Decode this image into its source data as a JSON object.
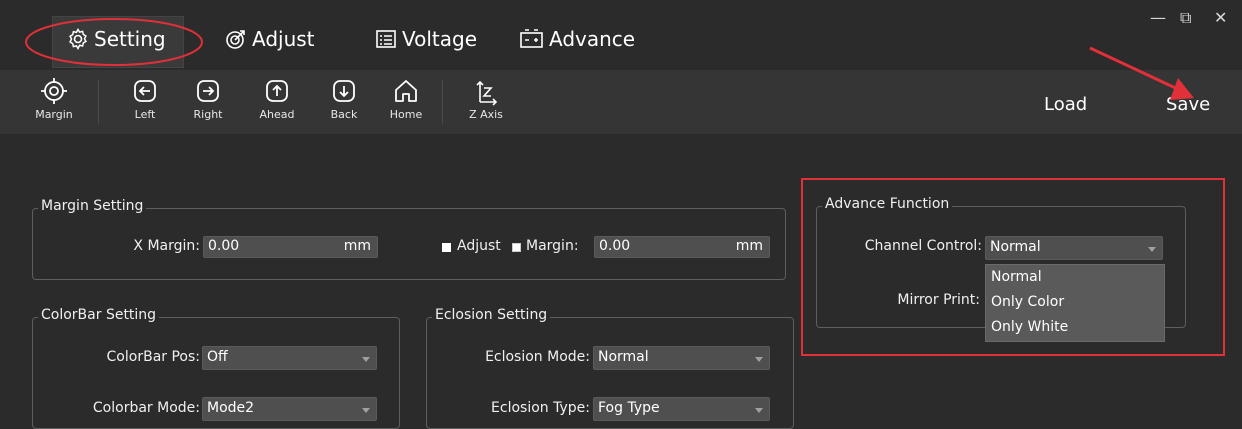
{
  "tabs": [
    {
      "label": "Setting",
      "icon": "gear-icon"
    },
    {
      "label": "Adjust",
      "icon": "target-icon"
    },
    {
      "label": "Voltage",
      "icon": "list-icon"
    },
    {
      "label": "Advance",
      "icon": "battery-icon"
    }
  ],
  "window": {
    "minimize": "—",
    "restore": "⧉",
    "close": "✕"
  },
  "toolbar": {
    "tools": [
      {
        "label": "Margin",
        "icon": "crosshair-icon"
      },
      {
        "label": "Left",
        "icon": "arrow-left-icon"
      },
      {
        "label": "Right",
        "icon": "arrow-right-icon"
      },
      {
        "label": "Ahead",
        "icon": "arrow-up-icon"
      },
      {
        "label": "Back",
        "icon": "arrow-down-icon"
      },
      {
        "label": "Home",
        "icon": "home-icon"
      },
      {
        "label": "Z Axis",
        "icon": "z-axis-icon"
      }
    ],
    "load": "Load",
    "save": "Save"
  },
  "margin_setting": {
    "title": "Margin Setting",
    "x_margin_label": "X Margin:",
    "x_margin_value": "0.00",
    "x_margin_unit": "mm",
    "adjust_label": "Adjust",
    "margin_label": "Margin:",
    "margin_value": "0.00",
    "margin_unit": "mm"
  },
  "colorbar_setting": {
    "title": "ColorBar Setting",
    "pos_label": "ColorBar Pos:",
    "pos_value": "Off",
    "mode_label": "Colorbar Mode:",
    "mode_value": "Mode2"
  },
  "eclosion_setting": {
    "title": "Eclosion Setting",
    "mode_label": "Eclosion Mode:",
    "mode_value": "Normal",
    "type_label": "Eclosion Type:",
    "type_value": "Fog Type"
  },
  "advance_function": {
    "title": "Advance Function",
    "channel_label": "Channel Control:",
    "channel_value": "Normal",
    "mirror_label": "Mirror Print:",
    "channel_options": [
      "Normal",
      "Only Color",
      "Only White"
    ]
  },
  "colors": {
    "highlight": "#e0303a",
    "background": "#2b2b2b",
    "toolbar": "#353535"
  }
}
